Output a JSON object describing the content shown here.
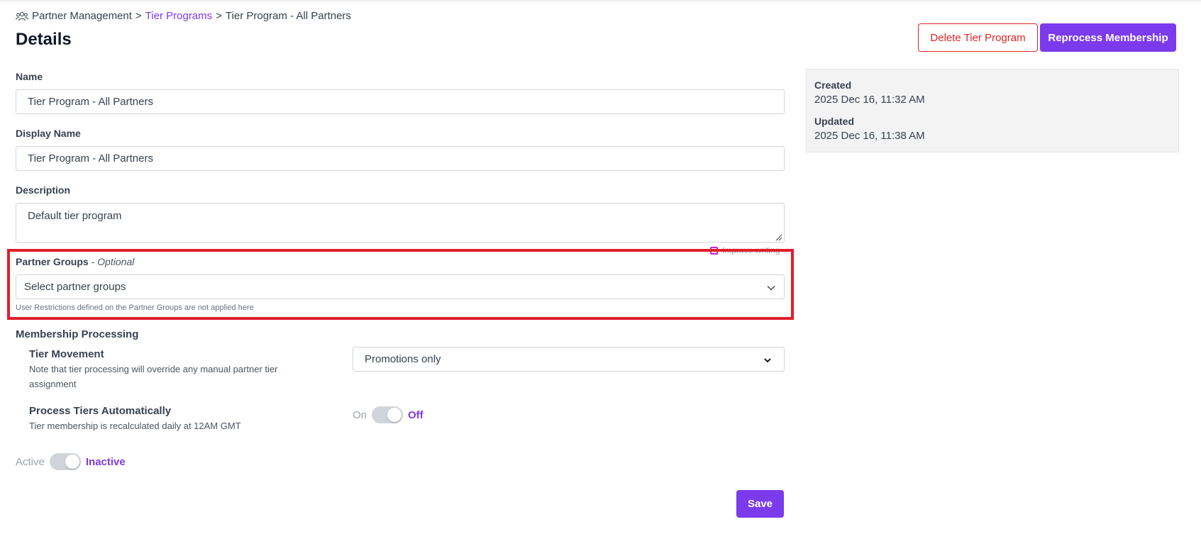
{
  "breadcrumb": {
    "root": "Partner Management",
    "separator": ">",
    "parent": "Tier Programs",
    "current": "Tier Program - All Partners"
  },
  "page": {
    "title": "Details"
  },
  "actions": {
    "delete_label": "Delete Tier Program",
    "reprocess_label": "Reprocess Membership"
  },
  "meta": {
    "created_label": "Created",
    "created_value": "2025 Dec 16, 11:32 AM",
    "updated_label": "Updated",
    "updated_value": "2025 Dec 16, 11:38 AM"
  },
  "form": {
    "name_label": "Name",
    "name_value": "Tier Program - All Partners",
    "display_name_label": "Display Name",
    "display_name_value": "Tier Program - All Partners",
    "description_label": "Description",
    "description_value": "Default tier program",
    "improve_writing": "Improve writing",
    "partner_groups_label": "Partner Groups",
    "partner_groups_optional": "- Optional",
    "partner_groups_placeholder": "Select partner groups",
    "partner_groups_help": "User Restrictions defined on the Partner Groups are not applied here",
    "membership_processing_label": "Membership Processing",
    "tier_movement_label": "Tier Movement",
    "tier_movement_desc": "Note that tier processing will override any manual partner tier assignment",
    "tier_movement_value": "Promotions only",
    "process_auto_label": "Process Tiers Automatically",
    "process_auto_desc": "Tier membership is recalculated daily at 12AM GMT",
    "process_auto_on": "On",
    "process_auto_off": "Off",
    "active_on": "Active",
    "active_off": "Inactive",
    "save_label": "Save"
  },
  "colors": {
    "accent": "#7c3aed",
    "danger": "#dc2626",
    "highlight": "#e11d2a"
  }
}
